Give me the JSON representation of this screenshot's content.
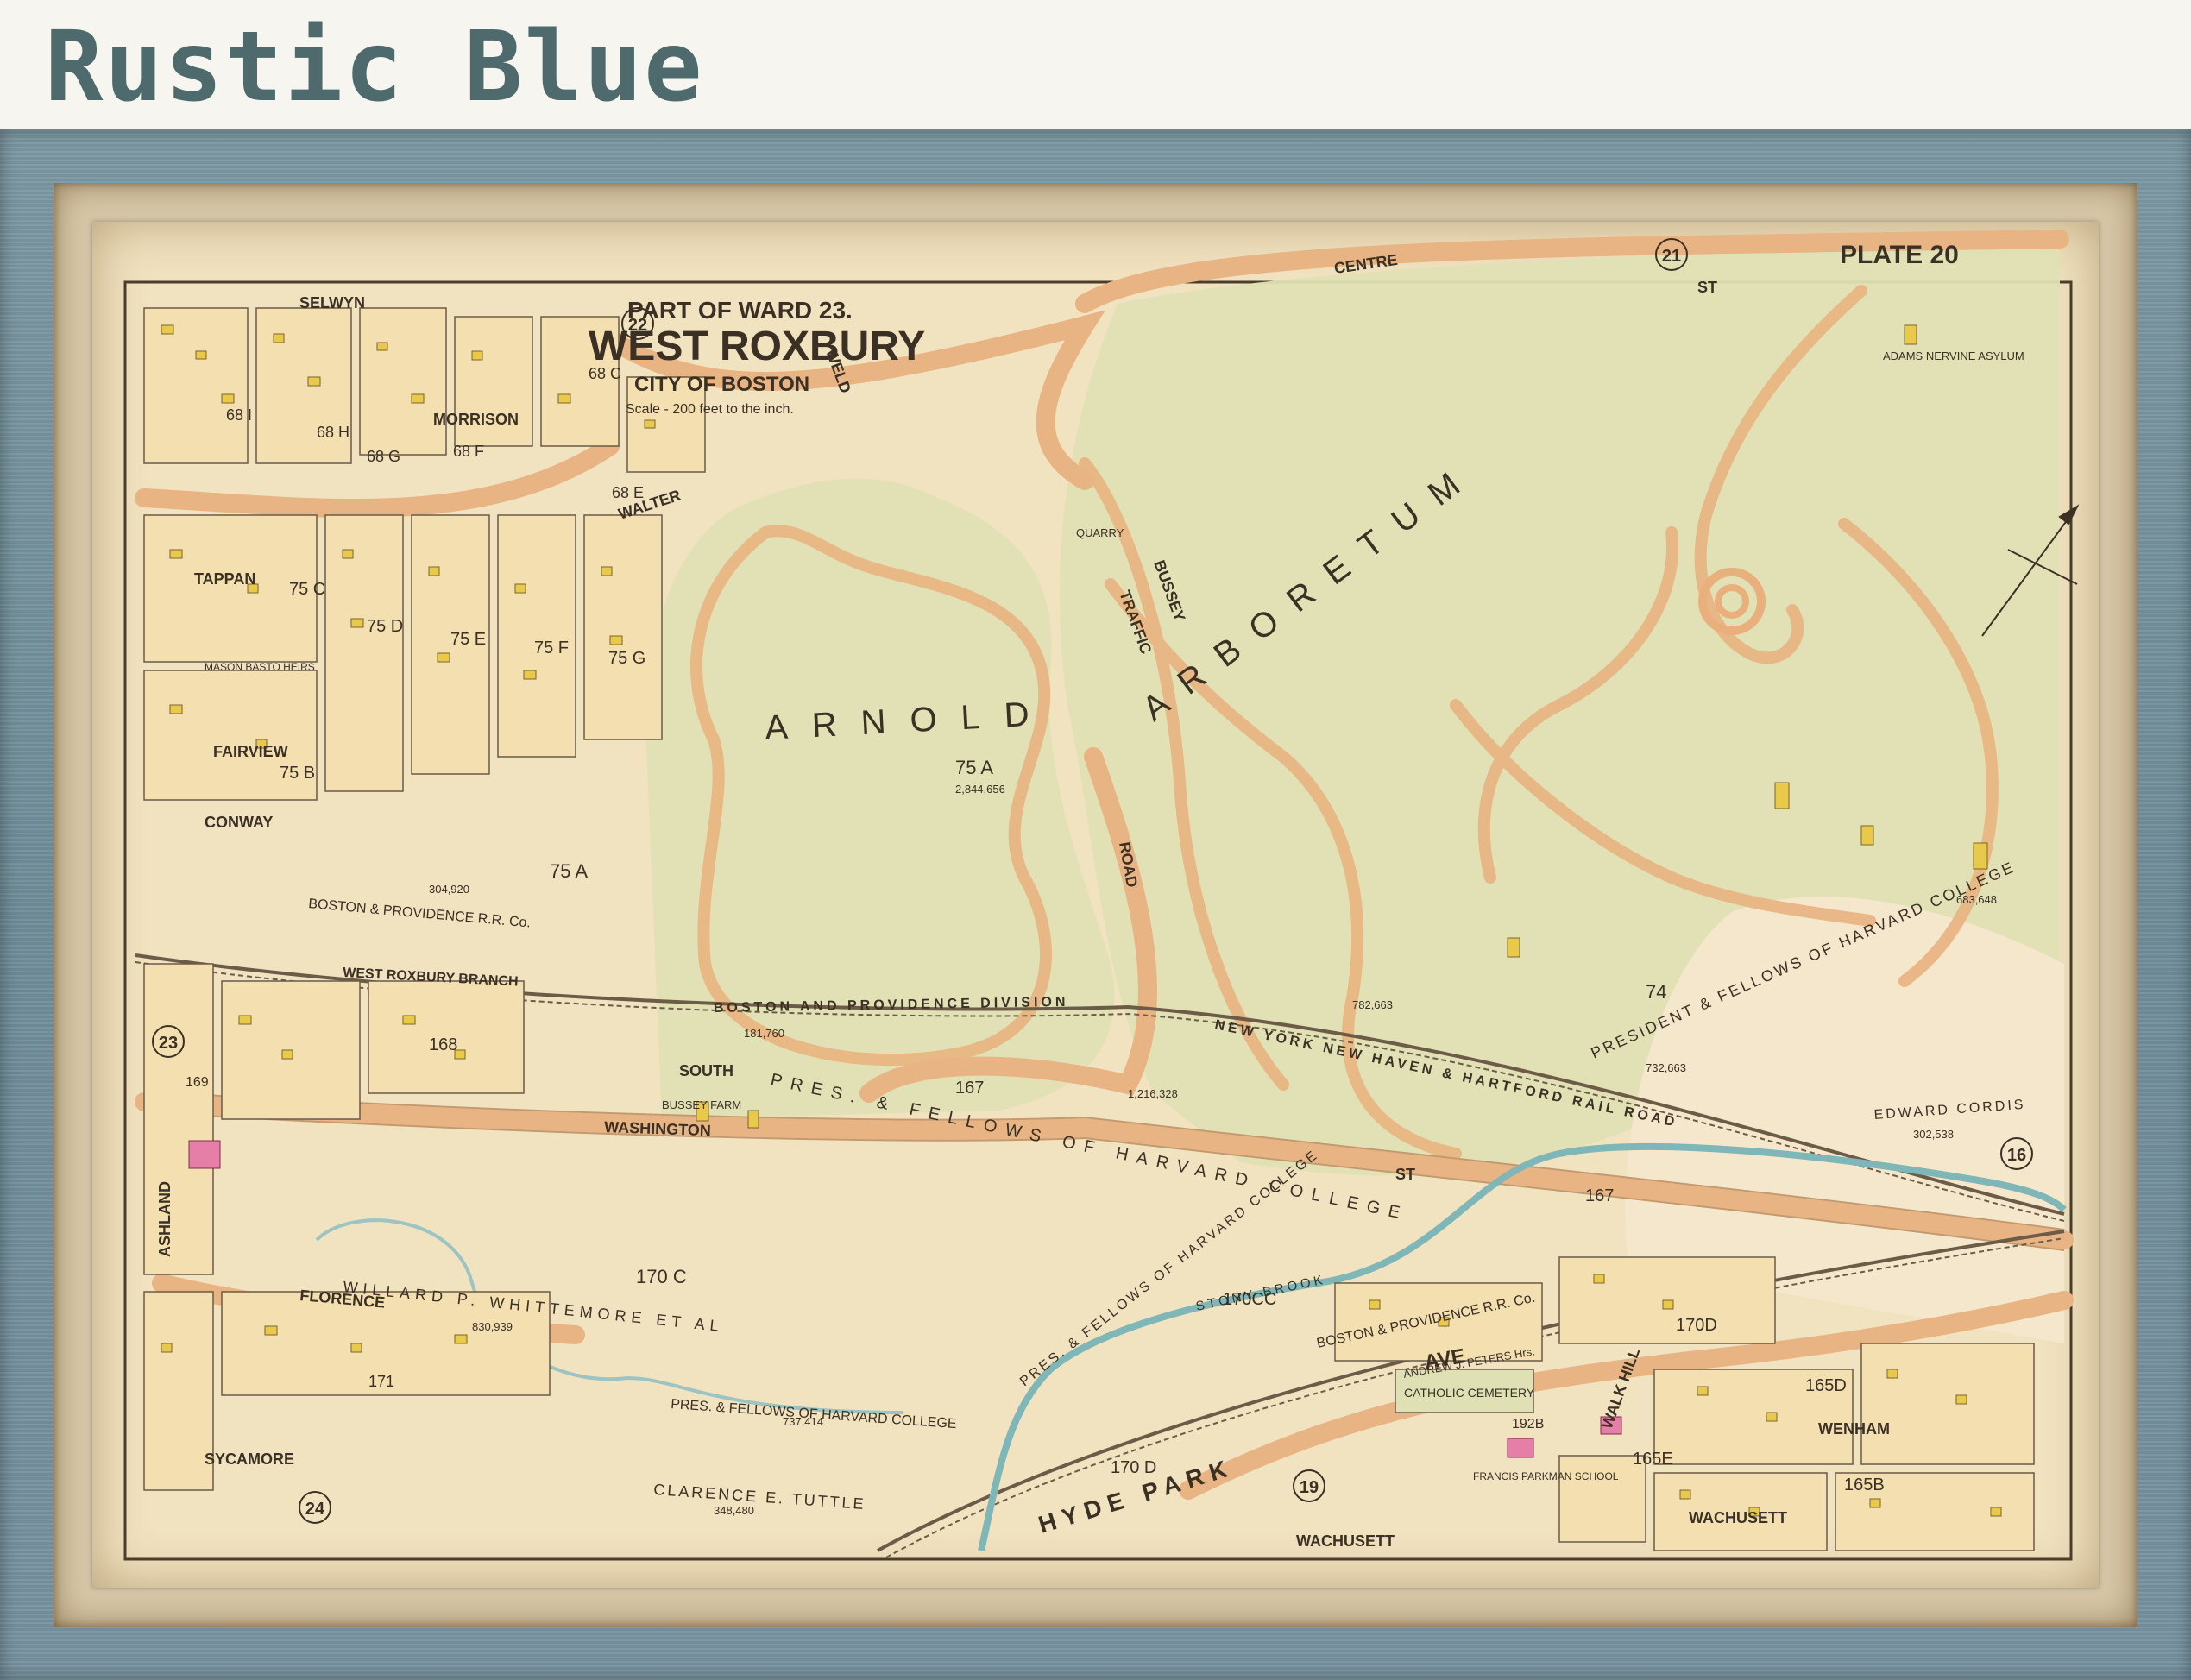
{
  "header": {
    "title": "Rustic Blue"
  },
  "map": {
    "title": {
      "line1": "PART OF WARD 23.",
      "line2": "WEST ROXBURY",
      "line3": "CITY OF BOSTON",
      "scale": "Scale - 200 feet to the inch."
    },
    "plate": "PLATE 20",
    "plate_numbers": [
      "21",
      "22",
      "23",
      "24",
      "19",
      "16"
    ],
    "park_label": [
      "ARNOLD",
      "ARBORETUM"
    ],
    "streets": {
      "centre": "CENTRE",
      "st": "ST",
      "selwyn": "SELWYN",
      "morrison": "MORRISON",
      "walter": "WALTER",
      "tappan": "TAPPAN",
      "fairview": "FAIRVIEW",
      "conway": "CONWAY",
      "washington": "WASHINGTON",
      "florence": "FLORENCE",
      "sycamore": "SYCAMORE",
      "south": "SOUTH",
      "hyde_park_ave": "HYDE  PARK",
      "ave": "AVE",
      "wachusett": "WACHUSETT",
      "wenham": "WENHAM",
      "bussey": "BUSSEY",
      "traffic": "TRAFFIC",
      "road": "ROAD",
      "ashland": "ASHLAND",
      "weld": "WELD",
      "walk_hill": "WALK HILL"
    },
    "rail": {
      "boston_providence": "BOSTON AND PROVIDENCE DIVISION",
      "nyh": "NEW YORK NEW HAVEN & HARTFORD RAIL ROAD",
      "wr_branch": "WEST ROXBURY BRANCH",
      "bp_rr": "BOSTON & PROVIDENCE R.R. Co."
    },
    "parcels": {
      "p75a_big": "75 A",
      "p75a_area": "2,844,656",
      "p75a_small": "75 A",
      "p74": "74",
      "p167": "167",
      "p167b": "167",
      "p168": "168",
      "p170c": "170 C",
      "p170cc": "170CC",
      "p170d": "170 D",
      "p170d2": "170D",
      "p165d": "165D",
      "p165b": "165B",
      "p165e": "165E",
      "p75b": "75 B",
      "p75c": "75 C",
      "p75d": "75 D",
      "p75e": "75 E",
      "p75f": "75 F",
      "p75g": "75 G",
      "p68c": "68 C",
      "p68e": "68 E",
      "p68f": "68 F",
      "p68g": "68 G",
      "p68h": "68 H",
      "p68i": "68 I",
      "p171": "171",
      "p169": "169",
      "p192b": "192B"
    },
    "owners": {
      "harvard1": "PRESIDENT & FELLOWS OF HARVARD COLLEGE",
      "harvard1_area": "732,663",
      "harvard2": "PRES. & FELLOWS OF HARVARD COLLEGE",
      "harvard3": "PRES. & FELLOWS OF HARVARD COLLEGE",
      "harvard3_area": "737,414",
      "harvard4": "PRES. & FELLOWS OF HARVARD COLLEGE",
      "willard": "WILLARD  P. WHITTEMORE  ET AL",
      "willard_area": "830,939",
      "tuttle": "CLARENCE E. TUTTLE",
      "tuttle_area": "348,480",
      "cordis": "EDWARD CORDIS",
      "cordis_area": "302,538",
      "adams": "ADAMS NERVINE ASYLUM",
      "bussey_farm": "BUSSEY FARM",
      "quarry": "QUARRY",
      "cemetery": "CATHOLIC CEMETERY",
      "stony_brook": "STONY BROOK",
      "parkman_school": "FRANCIS PARKMAN SCHOOL",
      "peters": "ANDREW J. PETERS Hrs.",
      "mason": "MASON BASTO HEIRS",
      "area_181": "181,760",
      "area_1216": "1,216,328",
      "area_304": "304,920",
      "area_683": "683,648",
      "area_782": "782,663"
    }
  }
}
